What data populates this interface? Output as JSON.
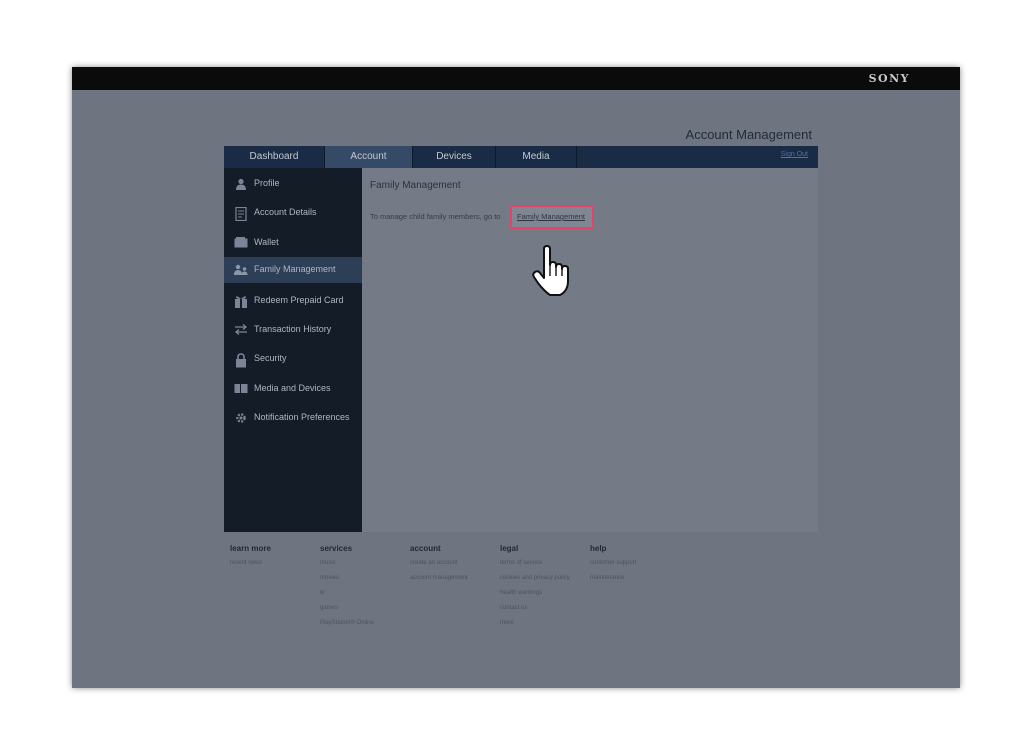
{
  "brand": "SONY",
  "page_title": "Account Management",
  "tabs": [
    {
      "label": "Dashboard",
      "active": false
    },
    {
      "label": "Account",
      "active": true
    },
    {
      "label": "Devices",
      "active": false
    },
    {
      "label": "Media",
      "active": false
    }
  ],
  "signout_label": "Sign Out",
  "sidebar": {
    "items": [
      {
        "label": "Profile",
        "icon": "person-icon"
      },
      {
        "label": "Account Details",
        "icon": "document-icon"
      },
      {
        "label": "Wallet",
        "icon": "wallet-icon"
      },
      {
        "label": "Family Management",
        "icon": "family-icon",
        "active": true
      },
      {
        "label": "Redeem Prepaid Card",
        "icon": "gift-card-icon"
      },
      {
        "label": "Transaction History",
        "icon": "transfer-arrows-icon"
      },
      {
        "label": "Security",
        "icon": "lock-icon"
      },
      {
        "label": "Media and Devices",
        "icon": "media-icon"
      },
      {
        "label": "Notification Preferences",
        "icon": "gear-icon"
      }
    ]
  },
  "content": {
    "title": "Family Management",
    "text": "To manage child family members, go to",
    "link": "Family Management"
  },
  "footer": {
    "columns": [
      {
        "heading": "learn more",
        "links": [
          "recent news"
        ]
      },
      {
        "heading": "services",
        "links": [
          "music",
          "movies",
          "tv",
          "games",
          "PlayStation® Online"
        ]
      },
      {
        "heading": "account",
        "links": [
          "create an account",
          "account management"
        ]
      },
      {
        "heading": "legal",
        "links": [
          "terms of service",
          "cookies and privacy policy",
          "health warnings",
          "contact us",
          "more"
        ]
      },
      {
        "heading": "help",
        "links": [
          "customer support",
          "maintenance"
        ]
      }
    ]
  },
  "colors": {
    "topbar": "#0b0b0c",
    "tabbar": "#1a2b45",
    "sidebar": "#141c28",
    "highlight_border": "#e0456a"
  }
}
